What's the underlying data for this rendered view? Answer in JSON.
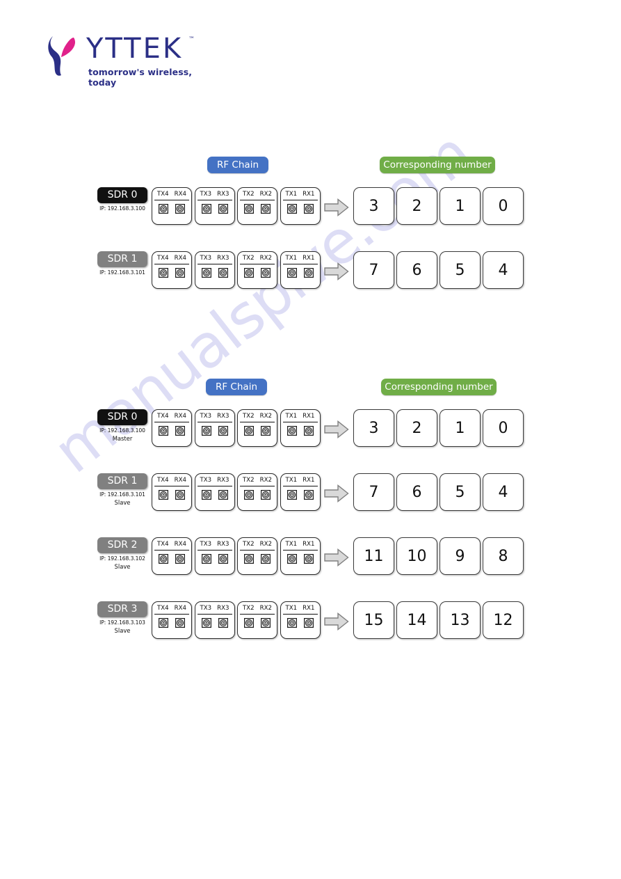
{
  "logo": {
    "wordmark": "YTTEK",
    "trademark": "™",
    "tagline": "tomorrow's wireless, today",
    "mark_color_primary": "#2b2f86",
    "mark_color_accent": "#e0218a"
  },
  "colors": {
    "rf_chain_pill": "#4472C4",
    "corresponding_number_pill": "#70AD47",
    "sdr_master_chip": "#111111",
    "sdr_slave_chip": "#808080",
    "watermark": "#c9c9ef"
  },
  "watermark": {
    "text": "manualspive.com"
  },
  "diagrams": [
    {
      "id": "diagram-single-sdr-pair",
      "headers": {
        "rf_chain": "RF Chain",
        "corresponding_number": "Corresponding number"
      },
      "rows": [
        {
          "name": "SDR 0",
          "ip": "IP: 192.168.3.100",
          "role": "",
          "chip_style": "black",
          "chains": [
            {
              "tx": "TX4",
              "rx": "RX4"
            },
            {
              "tx": "TX3",
              "rx": "RX3"
            },
            {
              "tx": "TX2",
              "rx": "RX2"
            },
            {
              "tx": "TX1",
              "rx": "RX1"
            }
          ],
          "numbers": [
            "3",
            "2",
            "1",
            "0"
          ]
        },
        {
          "name": "SDR 1",
          "ip": "IP: 192.168.3.101",
          "role": "",
          "chip_style": "grey",
          "chains": [
            {
              "tx": "TX4",
              "rx": "RX4"
            },
            {
              "tx": "TX3",
              "rx": "RX3"
            },
            {
              "tx": "TX2",
              "rx": "RX2"
            },
            {
              "tx": "TX1",
              "rx": "RX1"
            }
          ],
          "numbers": [
            "7",
            "6",
            "5",
            "4"
          ]
        }
      ]
    },
    {
      "id": "diagram-four-sdr-cluster",
      "headers": {
        "rf_chain": "RF Chain",
        "corresponding_number": "Corresponding number"
      },
      "rows": [
        {
          "name": "SDR 0",
          "ip": "IP: 192.168.3.100",
          "role": "Master",
          "chip_style": "black",
          "chains": [
            {
              "tx": "TX4",
              "rx": "RX4"
            },
            {
              "tx": "TX3",
              "rx": "RX3"
            },
            {
              "tx": "TX2",
              "rx": "RX2"
            },
            {
              "tx": "TX1",
              "rx": "RX1"
            }
          ],
          "numbers": [
            "3",
            "2",
            "1",
            "0"
          ]
        },
        {
          "name": "SDR 1",
          "ip": "IP: 192.168.3.101",
          "role": "Slave",
          "chip_style": "grey",
          "chains": [
            {
              "tx": "TX4",
              "rx": "RX4"
            },
            {
              "tx": "TX3",
              "rx": "RX3"
            },
            {
              "tx": "TX2",
              "rx": "RX2"
            },
            {
              "tx": "TX1",
              "rx": "RX1"
            }
          ],
          "numbers": [
            "7",
            "6",
            "5",
            "4"
          ]
        },
        {
          "name": "SDR 2",
          "ip": "IP: 192.168.3.102",
          "role": "Slave",
          "chip_style": "grey",
          "chains": [
            {
              "tx": "TX4",
              "rx": "RX4"
            },
            {
              "tx": "TX3",
              "rx": "RX3"
            },
            {
              "tx": "TX2",
              "rx": "RX2"
            },
            {
              "tx": "TX1",
              "rx": "RX1"
            }
          ],
          "numbers": [
            "11",
            "10",
            "9",
            "8"
          ]
        },
        {
          "name": "SDR 3",
          "ip": "IP: 192.168.3.103",
          "role": "Slave",
          "chip_style": "grey",
          "chains": [
            {
              "tx": "TX4",
              "rx": "RX4"
            },
            {
              "tx": "TX3",
              "rx": "RX3"
            },
            {
              "tx": "TX2",
              "rx": "RX2"
            },
            {
              "tx": "TX1",
              "rx": "RX1"
            }
          ],
          "numbers": [
            "15",
            "14",
            "13",
            "12"
          ]
        }
      ]
    }
  ],
  "icons": {
    "rf_port": "sma-connector-icon",
    "flow": "right-block-arrow-icon"
  }
}
